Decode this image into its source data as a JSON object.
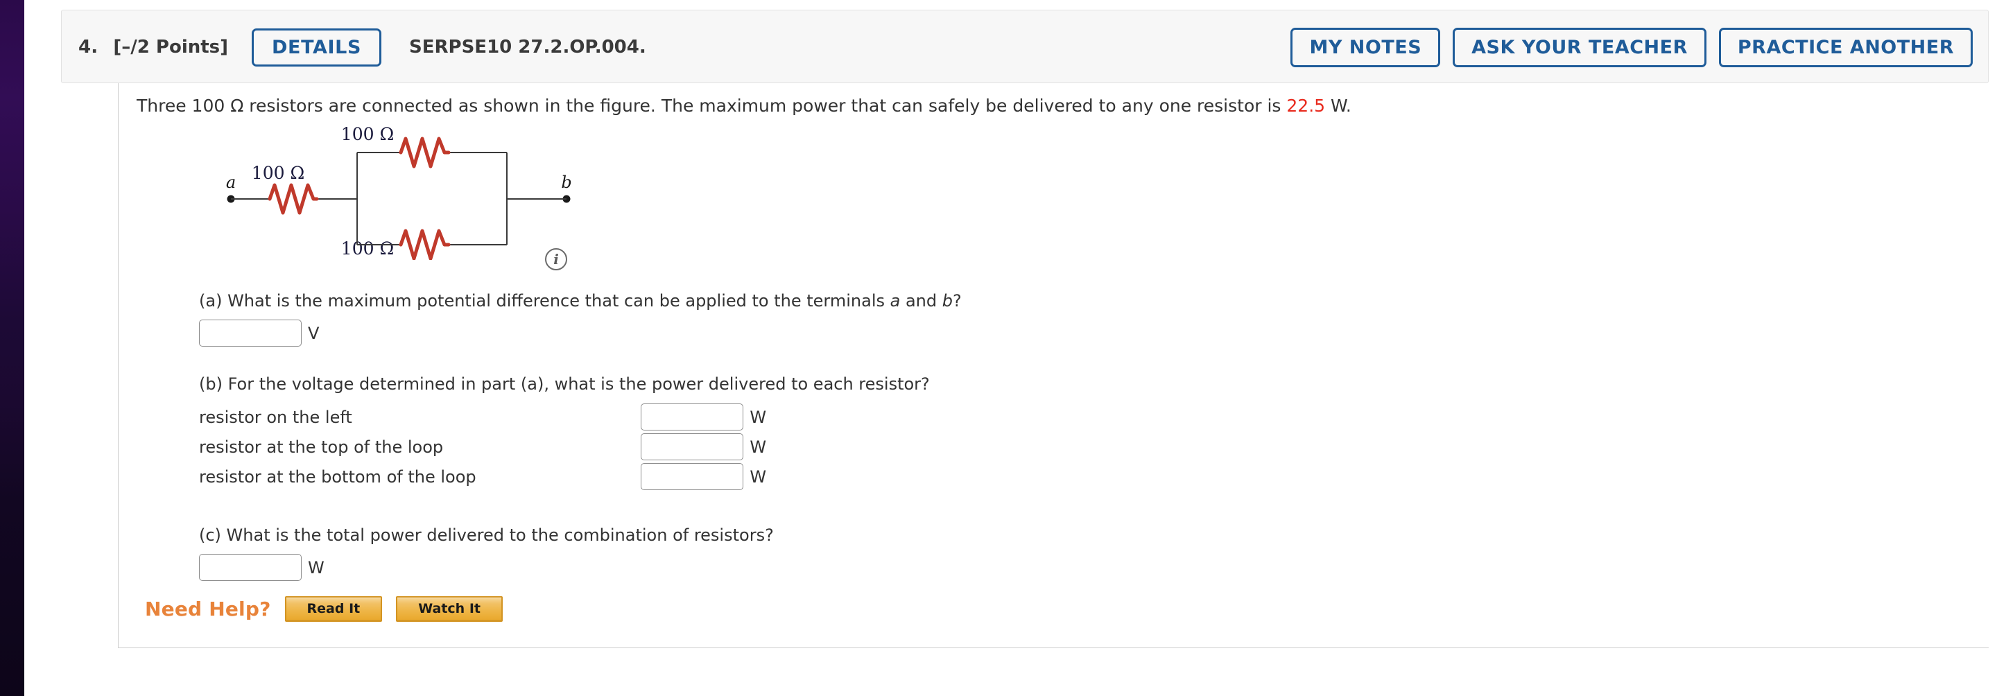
{
  "header": {
    "question_number": "4.",
    "points": "[–/2 Points]",
    "details_label": "DETAILS",
    "problem_id": "SERPSE10 27.2.OP.004.",
    "my_notes_label": "MY NOTES",
    "ask_your_teacher_label": "ASK YOUR TEACHER",
    "practice_another_label": "PRACTICE ANOTHER",
    "accent_blue": "#1f5c99"
  },
  "stem": {
    "text_before": "Three 100 Ω resistors are connected as shown in the figure. The maximum power that can safely be delivered to any one resistor is ",
    "highlight_value": "22.5",
    "text_after": " W.",
    "highlight_color": "#e8291c"
  },
  "figure": {
    "terminal_a": "a",
    "terminal_b": "b",
    "label_left": "100 Ω",
    "label_top": "100 Ω",
    "label_bottom": "100 Ω",
    "info_icon": "i",
    "resistor_color": "#c0392b",
    "wire_color": "#3a3a3a"
  },
  "parts": [
    {
      "question": "(a) What is the maximum potential difference that can be applied to the terminals a and b?",
      "value": "",
      "unit": "V"
    },
    {
      "question": "(b) For the voltage determined in part (a), what is the power delivered to each resistor?",
      "rows": [
        {
          "label": "resistor on the left",
          "value": "",
          "unit": "W"
        },
        {
          "label": "resistor at the top of the loop",
          "value": "",
          "unit": "W"
        },
        {
          "label": "resistor at the bottom of the loop",
          "value": "",
          "unit": "W"
        }
      ]
    },
    {
      "question": "(c) What is the total power delivered to the combination of resistors?",
      "value": "",
      "unit": "W"
    }
  ],
  "need_help": {
    "label": "Need Help?",
    "read_it_label": "Read It",
    "watch_it_label": "Watch It",
    "label_color": "#e8833a"
  }
}
